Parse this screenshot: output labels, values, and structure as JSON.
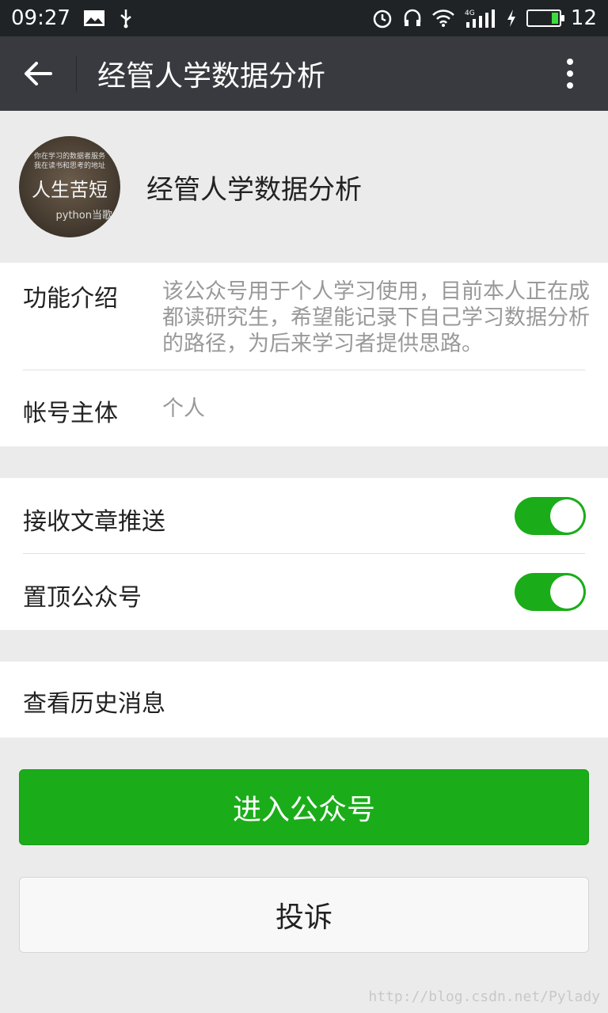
{
  "status_bar": {
    "time": "09:27",
    "battery_level": "12",
    "network_label": "4G",
    "icons": [
      "image-icon",
      "usb-icon",
      "alarm-icon",
      "headset-icon",
      "wifi-icon",
      "signal-icon",
      "charging-icon",
      "battery-icon"
    ]
  },
  "header": {
    "title": "经管人学数据分析",
    "back_icon": "arrow-left-icon",
    "more_icon": "more-vertical-icon"
  },
  "profile": {
    "name": "经管人学数据分析",
    "avatar_text": {
      "line1": "你在学习的数据者服务",
      "line2": "我在读书和思考的地址",
      "main": "人生苦短",
      "tag": "python当歌"
    }
  },
  "info": {
    "intro_label": "功能介绍",
    "intro_text": "该公众号用于个人学习使用，目前本人正在成都读研究生，希望能记录下自己学习数据分析的路径，为后来学习者提供思路。",
    "account_label": "帐号主体",
    "account_value": "个人"
  },
  "settings": {
    "receive_push_label": "接收文章推送",
    "receive_push_on": true,
    "pin_top_label": "置顶公众号",
    "pin_top_on": true
  },
  "history": {
    "label": "查看历史消息"
  },
  "buttons": {
    "enter_label": "进入公众号",
    "report_label": "投诉"
  },
  "colors": {
    "accent_green": "#1aad19",
    "header_bg": "#393a3f",
    "status_bg": "#1f2326"
  },
  "watermark": "http://blog.csdn.net/Pylady"
}
